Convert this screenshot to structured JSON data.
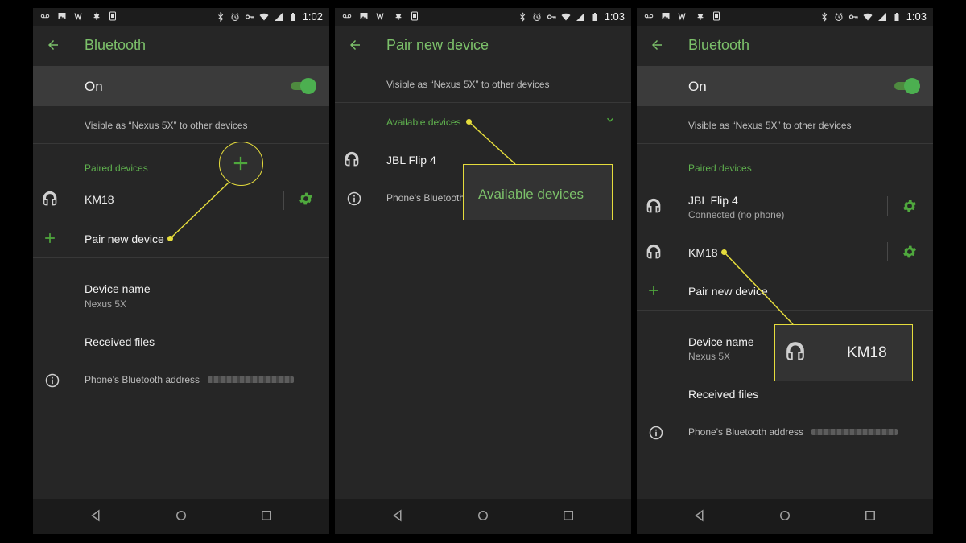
{
  "panels": [
    {
      "status": {
        "time": "1:02"
      },
      "appbar": {
        "title": "Bluetooth"
      },
      "toggle_row": {
        "label": "On",
        "state": true
      },
      "visible_as": "Visible as “Nexus 5X” to other devices",
      "paired_header": "Paired devices",
      "paired_devices": [
        {
          "name": "KM18"
        }
      ],
      "pair_new": "Pair new device",
      "device_name": {
        "label": "Device name",
        "value": "Nexus 5X"
      },
      "received_files": "Received files",
      "bt_address_label": "Phone's Bluetooth address"
    },
    {
      "status": {
        "time": "1:03"
      },
      "appbar": {
        "title": "Pair new device"
      },
      "visible_as": "Visible as “Nexus 5X” to other devices",
      "available_header": "Available devices",
      "available_devices": [
        {
          "name": "JBL Flip 4"
        }
      ],
      "bt_address_label": "Phone's Bluetooth"
    },
    {
      "status": {
        "time": "1:03"
      },
      "appbar": {
        "title": "Bluetooth"
      },
      "toggle_row": {
        "label": "On",
        "state": true
      },
      "visible_as": "Visible as “Nexus 5X” to other devices",
      "paired_header": "Paired devices",
      "paired_devices": [
        {
          "name": "JBL Flip 4",
          "status": "Connected (no phone)"
        },
        {
          "name": "KM18"
        }
      ],
      "pair_new": "Pair new device",
      "device_name": {
        "label": "Device name",
        "value": "Nexus 5X"
      },
      "received_files": "Received files",
      "bt_address_label": "Phone's Bluetooth address"
    }
  ],
  "callouts": {
    "available_devices": "Available devices",
    "km18": "KM18"
  },
  "colors": {
    "accent": "#7cc06a",
    "header_green": "#5fb14e",
    "highlight": "#e5dc3c",
    "background": "#262626"
  }
}
